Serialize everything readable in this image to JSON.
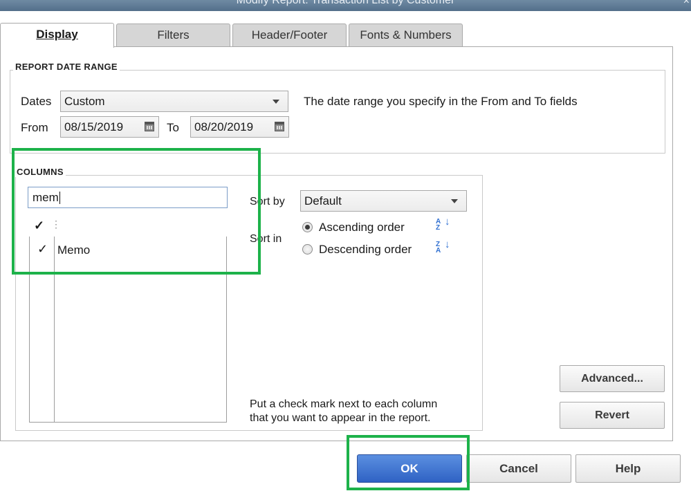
{
  "window": {
    "title": "Modify Report: Transaction List by Customer",
    "close_glyph": "×"
  },
  "tabs": [
    {
      "label": "Display",
      "active": true
    },
    {
      "label": "Filters"
    },
    {
      "label": "Header/Footer"
    },
    {
      "label": "Fonts & Numbers"
    }
  ],
  "date_range": {
    "group_label": "REPORT DATE RANGE",
    "dates_label": "Dates",
    "dates_value": "Custom",
    "from_label": "From",
    "from_value": "08/15/2019",
    "to_label": "To",
    "to_value": "08/20/2019",
    "hint": "The date range you specify in the From and To fields"
  },
  "columns": {
    "group_label": "COLUMNS",
    "search_value": "mem",
    "header_check": "✓",
    "header_grip": "⋮",
    "items": [
      {
        "check": "✓",
        "label": "Memo"
      }
    ],
    "help_line1": "Put a check mark next to each column",
    "help_line2": "that you want to appear in the report."
  },
  "sort": {
    "sort_by_label": "Sort by",
    "sort_by_value": "Default",
    "sort_in_label": "Sort in",
    "ascending_label": "Ascending order",
    "descending_label": "Descending order",
    "selected": "ascending",
    "asc_icon_top": "A Z",
    "desc_icon_top": "Z A",
    "arrow": "↓"
  },
  "buttons": {
    "advanced": "Advanced...",
    "revert": "Revert",
    "ok": "OK",
    "cancel": "Cancel",
    "help": "Help"
  },
  "colors": {
    "highlight": "#1db24a",
    "primary_button": "#3a6fd0"
  }
}
